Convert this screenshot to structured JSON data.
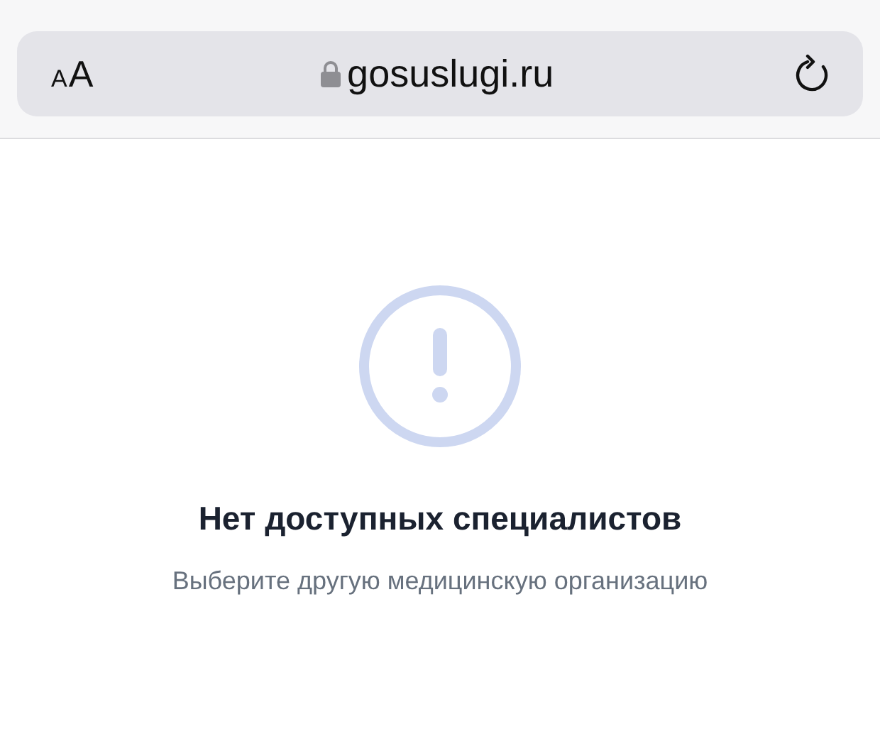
{
  "address_bar": {
    "text_size_button": {
      "small": "A",
      "large": "A"
    },
    "secure": true,
    "url": "gosuslugi.ru"
  },
  "message": {
    "title": "Нет доступных специалистов",
    "subtitle": "Выберите другую медицинскую организацию"
  }
}
